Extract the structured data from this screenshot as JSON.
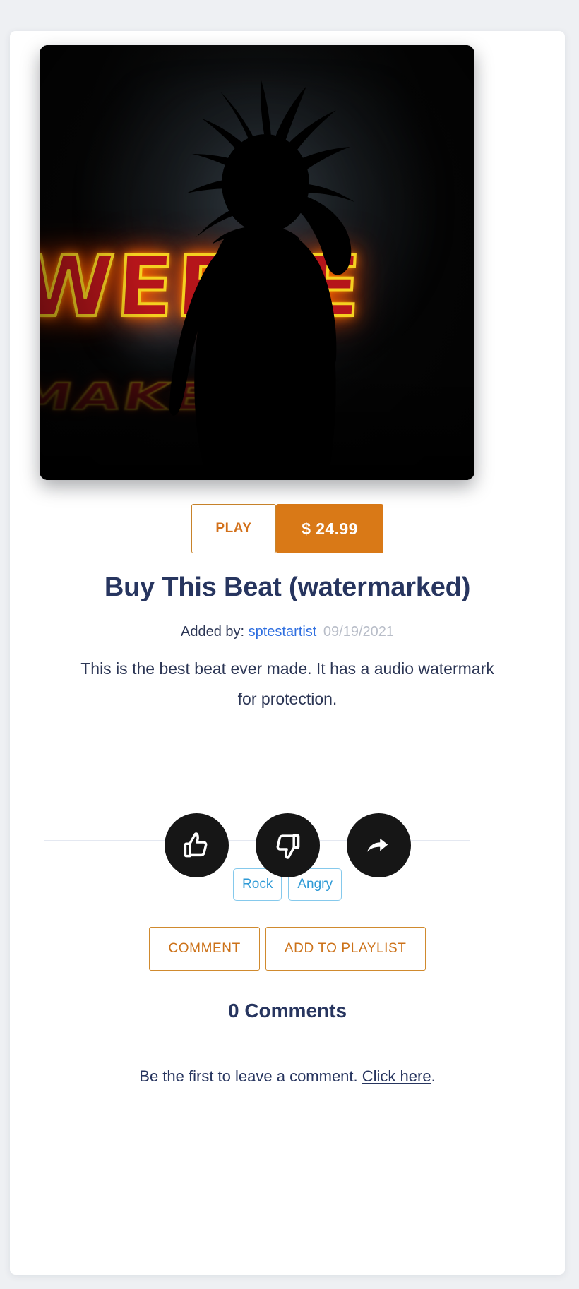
{
  "artwork": {
    "alt": "beat-cover-art",
    "neon_text": "WEEKE",
    "neon_reflection_text": "MAKE"
  },
  "transport": {
    "play_label": "PLAY",
    "price_label": "$ 24.99"
  },
  "beat": {
    "title": "Buy This Beat (watermarked)",
    "added_by_label": "Added by:",
    "artist": "sptestartist",
    "date": "09/19/2021",
    "description": "This is the best beat ever made. It has a audio watermark for protection."
  },
  "tags": [
    {
      "label": "Rock"
    },
    {
      "label": "Angry"
    }
  ],
  "reactions": [
    {
      "name": "thumbs-up-icon",
      "label": "Like"
    },
    {
      "name": "thumbs-down-icon",
      "label": "Dislike"
    },
    {
      "name": "share-icon",
      "label": "Share"
    }
  ],
  "actions": {
    "comment_label": "COMMENT",
    "add_to_playlist_label": "ADD TO PLAYLIST"
  },
  "comments": {
    "count_label": "0 Comments",
    "empty_prefix": "Be the first to leave a comment. ",
    "empty_link": "Click here",
    "empty_suffix": "."
  },
  "colors": {
    "accent_orange": "#d97917",
    "accent_orange_text": "#cc7219",
    "tag_blue": "#2e9ad6",
    "tag_border": "#85c9ec",
    "title_navy": "#27355f",
    "link_blue": "#2f6fe0",
    "date_gray": "#b8bdc8",
    "circle_black": "#161616",
    "page_bg": "#eef0f3",
    "card_bg": "#ffffff"
  }
}
